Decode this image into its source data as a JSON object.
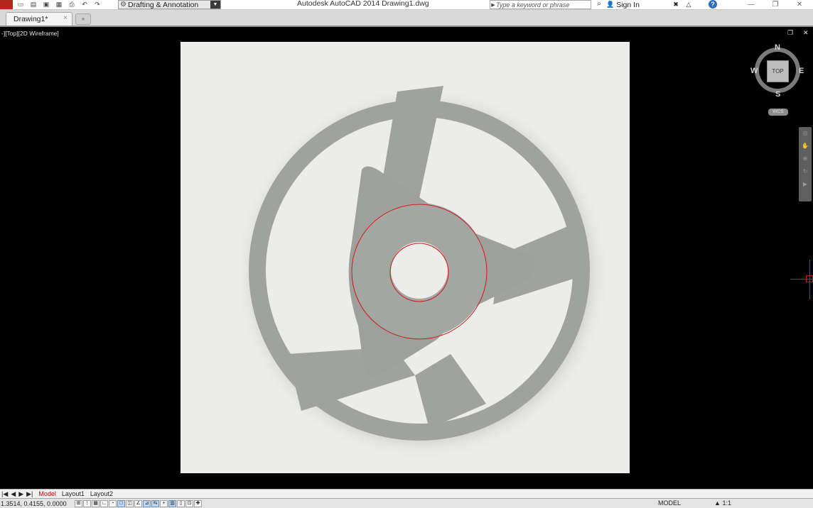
{
  "window": {
    "title": "Autodesk AutoCAD 2014    Drawing1.dwg",
    "minimize": "—",
    "restore": "❐",
    "close": "✕"
  },
  "toolbar": {
    "workspace": "Drafting & Annotation",
    "search_placeholder": "Type a keyword or phrase",
    "sign_in": "Sign In",
    "help": "?"
  },
  "tabs": [
    {
      "label": "Drawing1*",
      "close": "×"
    }
  ],
  "viewport": {
    "label": "-][Top][2D Wireframe]",
    "restore_icon": "❐",
    "close_icon": "✕"
  },
  "viewcube": {
    "face": "TOP",
    "north": "N",
    "south": "S",
    "east": "E",
    "west": "W",
    "ucs": "WCS"
  },
  "layout_tabs": [
    "Model",
    "Layout1",
    "Layout2"
  ],
  "status": {
    "coordinates": "1.3514, 0.4155, 0.0000",
    "space": "MODEL",
    "annotation_scale": "1:1"
  },
  "colors": {
    "accent_red": "#d01818",
    "model_space": "#000000",
    "paper": "#ececea"
  }
}
